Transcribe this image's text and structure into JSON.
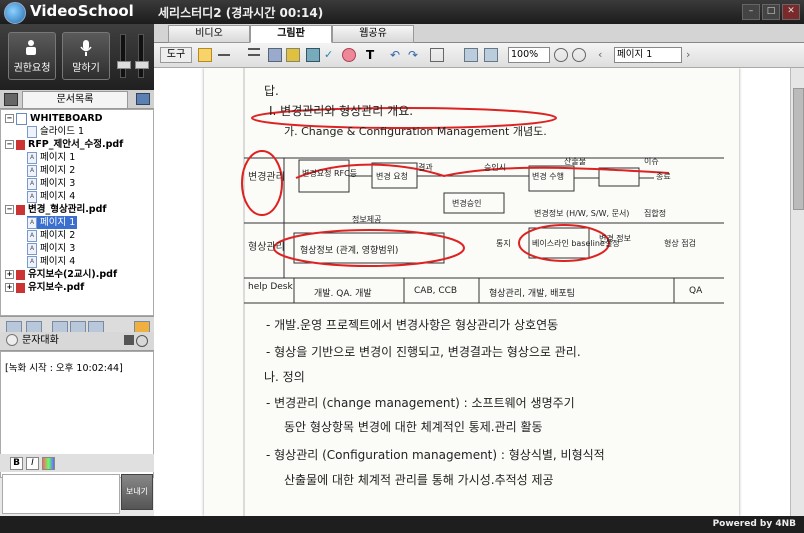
{
  "app": {
    "name": "VideoSchool",
    "session_title": "세리스터디2 (경과시간 00:14)"
  },
  "window_controls": {
    "minimize": "–",
    "maximize": "□",
    "close": "✕"
  },
  "left": {
    "buttons": [
      {
        "label": "권한요청"
      },
      {
        "label": "말하기"
      }
    ],
    "doc_tab": "문서목록",
    "tree": [
      {
        "label": "WHITEBOARD",
        "level": 0
      },
      {
        "label": "슬라이드 1",
        "level": 1
      },
      {
        "label": "RFP_제안서_수정.pdf",
        "level": 0
      },
      {
        "label": "페이지 1",
        "level": 1
      },
      {
        "label": "페이지 2",
        "level": 1
      },
      {
        "label": "페이지 3",
        "level": 1
      },
      {
        "label": "페이지 4",
        "level": 1
      },
      {
        "label": "변경_형상관리.pdf",
        "level": 0
      },
      {
        "label": "페이지 1",
        "level": 1,
        "selected": true
      },
      {
        "label": "페이지 2",
        "level": 1
      },
      {
        "label": "페이지 3",
        "level": 1
      },
      {
        "label": "페이지 4",
        "level": 1
      },
      {
        "label": "유지보수(2교시).pdf",
        "level": 0
      },
      {
        "label": "유지보수.pdf",
        "level": 0
      }
    ],
    "chat": {
      "title": "문자대화",
      "log": "[녹화 시작 : 오후 10:02:44]",
      "send_label": "보내기",
      "fmt_bold": "B",
      "fmt_italic": "I"
    }
  },
  "main": {
    "tabs": [
      {
        "label": "비디오"
      },
      {
        "label": "그림판",
        "active": true
      },
      {
        "label": "웹공유"
      }
    ],
    "toolbar": {
      "tool_label": "도구",
      "zoom": "100%",
      "page": "페이지 1"
    },
    "paper_lines": [
      {
        "text": "답."
      },
      {
        "text": "I.      변경관리와 형상관리 개요."
      },
      {
        "text": "가.  Change & Configuration Management 개념도."
      },
      {
        "text": "변경관리"
      },
      {
        "text": "형상관리"
      },
      {
        "text": "변경요청 RFC등"
      },
      {
        "text": "변경 요청"
      },
      {
        "text": "결과"
      },
      {
        "text": "승인시"
      },
      {
        "text": "변경 수행"
      },
      {
        "text": "산출물"
      },
      {
        "text": "이슈"
      },
      {
        "text": "종료"
      },
      {
        "text": "변경승인"
      },
      {
        "text": "정보제공"
      },
      {
        "text": "변경정보 (H/W, S/W, 문서)"
      },
      {
        "text": "통지"
      },
      {
        "text": "형상정보 (관계, 영향범위)"
      },
      {
        "text": "베이스라인 baseline설정"
      },
      {
        "text": "변경 정보"
      },
      {
        "text": "형상 점검"
      },
      {
        "text": "집합정"
      },
      {
        "text": "help Desk"
      },
      {
        "text": "개발. QA. 개발"
      },
      {
        "text": "CAB, CCB"
      },
      {
        "text": "형상관리, 개발, 배포팀"
      },
      {
        "text": "QA"
      },
      {
        "text": "- 개발.운영 프로젝트에서 변경사항은 형상관리가 상호연동"
      },
      {
        "text": "- 형상을 기반으로 변경이 진행되고, 변경결과는 형상으로 관리."
      },
      {
        "text": "나.   정의"
      },
      {
        "text": "- 변경관리 (change management) : 소프트웨어 생명주기"
      },
      {
        "text": "동안 형상항목 변경에 대한 체계적인 통제.관리 활동"
      },
      {
        "text": "- 형상관리 (Configuration management) : 형상식별, 비형식적"
      },
      {
        "text": "산출물에 대한 체계적 관리를 통해 가시성.추적성 제공"
      }
    ]
  },
  "footer": {
    "powered": "Powered by 4NB"
  }
}
